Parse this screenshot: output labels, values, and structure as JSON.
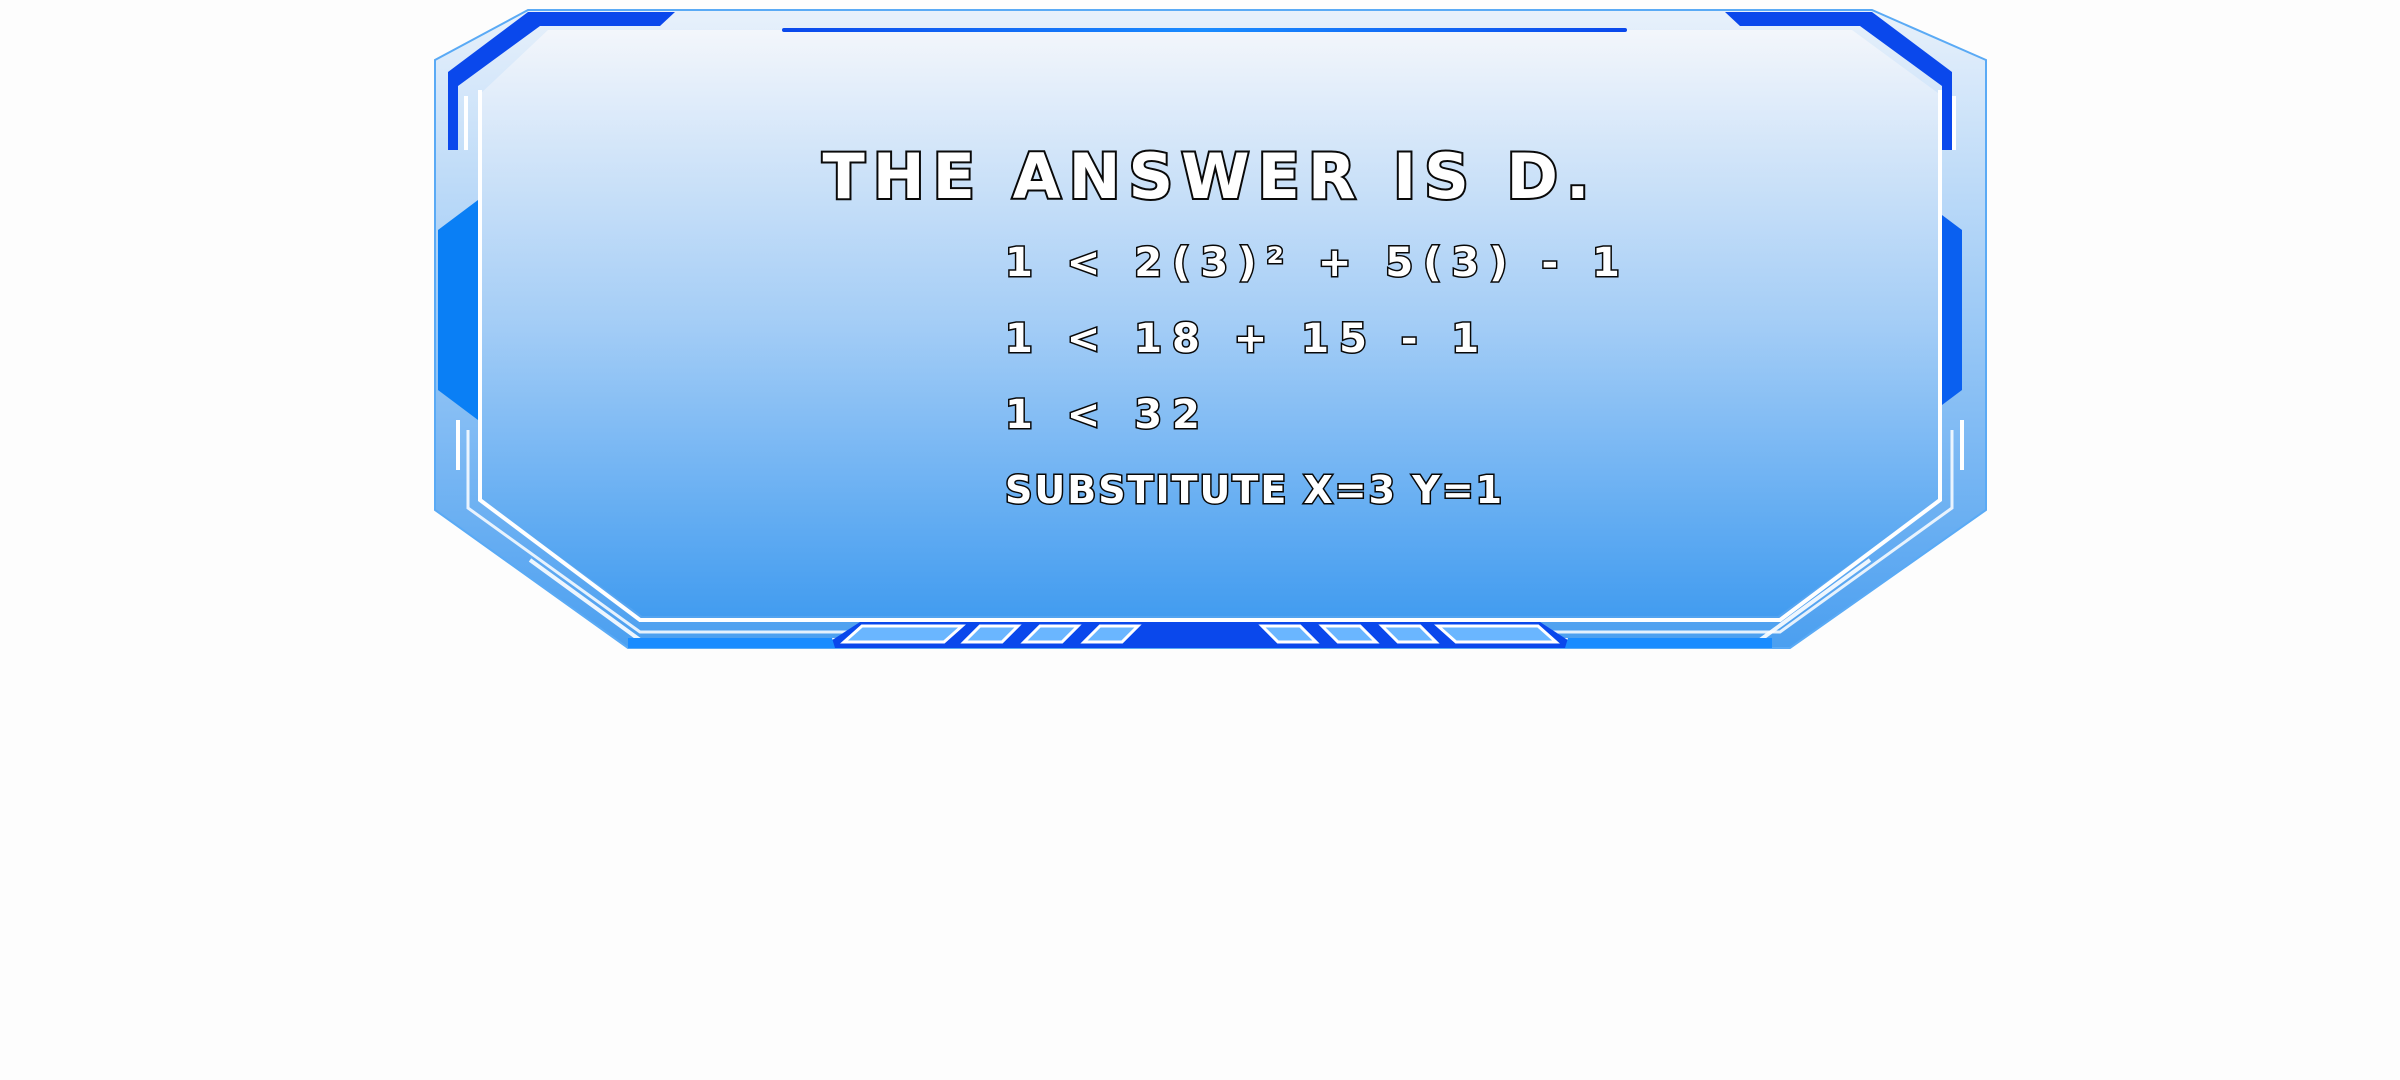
{
  "panel": {
    "title": "THE ANSWER IS D.",
    "steps": [
      "1 < 2(3)² + 5(3) - 1",
      "1 < 18 + 15 - 1",
      "1 < 32",
      "SUBSTITUTE X=3 Y=1"
    ]
  },
  "colors": {
    "frame_dark": "#0044ee",
    "frame_bright": "#1e90ff",
    "panel_top": "#f3f6fb",
    "panel_bottom": "#4aa0f0",
    "trim": "#ffffff"
  }
}
